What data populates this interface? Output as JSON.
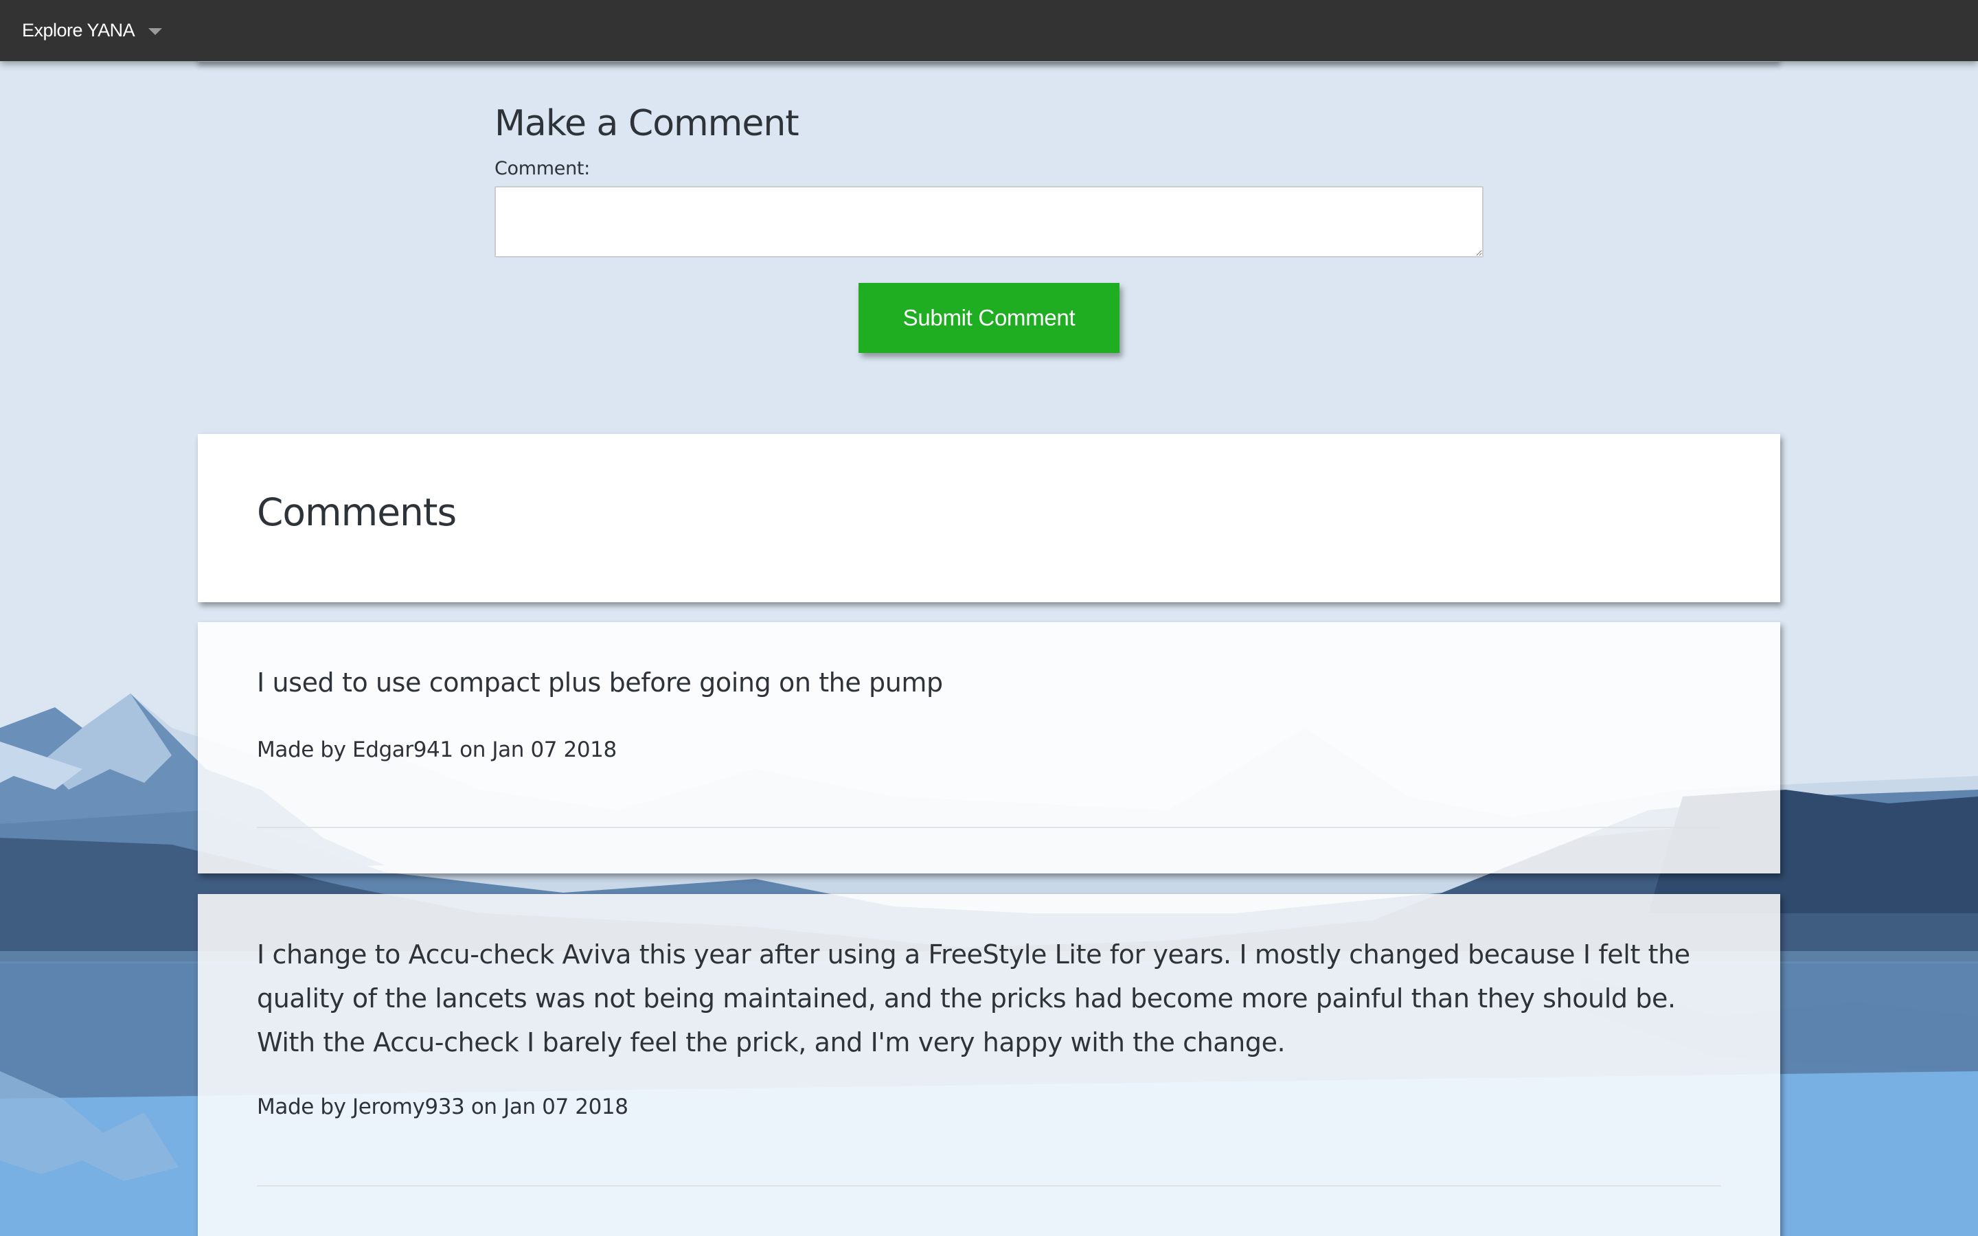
{
  "nav": {
    "brand": "Explore YANA"
  },
  "form": {
    "title": "Make a Comment",
    "label": "Comment:",
    "value": "",
    "submit_label": "Submit Comment"
  },
  "comments_section": {
    "title": "Comments",
    "items": [
      {
        "text": "I used to use compact plus before going on the pump",
        "meta": "Made by Edgar941 on Jan 07 2018"
      },
      {
        "text": "I change to Accu-check Aviva this year after using a FreeStyle Lite for years. I mostly changed because I felt the quality of the lancets was not being maintained, and the pricks had become more painful than they should be. With the Accu-check I barely feel the prick, and I'm very happy with the change.",
        "meta": "Made by Jeromy933 on Jan 07 2018"
      }
    ]
  },
  "colors": {
    "nav_bg": "#333333",
    "page_bg": "#dbe6f2",
    "submit_bg": "#1fae22",
    "text": "#2d3338"
  }
}
